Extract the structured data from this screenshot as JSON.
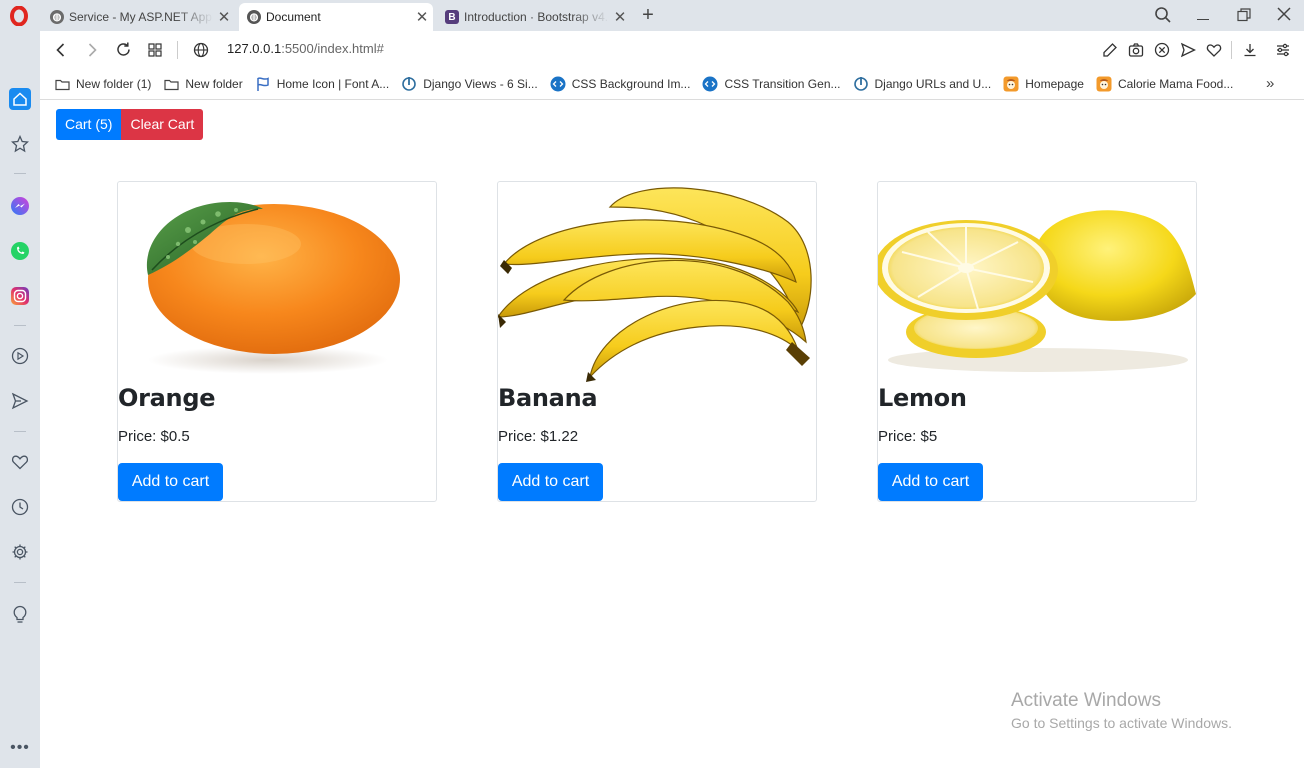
{
  "browser": {
    "tabs": [
      {
        "title": "Service - My ASP.NET Application",
        "active": false
      },
      {
        "title": "Document",
        "active": true
      },
      {
        "title": "Introduction · Bootstrap v4.6",
        "active": false
      }
    ],
    "url": {
      "host": "127.0.0.1",
      "rest": ":5500/index.html#"
    },
    "bookmarks": [
      {
        "label": "New folder (1)",
        "icon": "folder-icon"
      },
      {
        "label": "New folder",
        "icon": "folder-icon"
      },
      {
        "label": "Home Icon | Font A...",
        "icon": "flag-icon"
      },
      {
        "label": "Django Views - 6 Si...",
        "icon": "django-icon"
      },
      {
        "label": "CSS Background Im...",
        "icon": "code-icon"
      },
      {
        "label": "CSS Transition Gen...",
        "icon": "code-icon"
      },
      {
        "label": "Django URLs and U...",
        "icon": "django-icon"
      },
      {
        "label": "Homepage",
        "icon": "calorie-icon"
      },
      {
        "label": "Calorie Mama Food...",
        "icon": "calorie-icon"
      }
    ],
    "colors": {
      "accent": "#007bff",
      "danger": "#dc3545",
      "opera_red": "#e0261f"
    }
  },
  "page": {
    "cart_label": "Cart (5)",
    "clear_label": "Clear Cart",
    "products": [
      {
        "name": "Orange",
        "price": "Price: $0.5",
        "button": "Add to cart",
        "image": "orange-image"
      },
      {
        "name": "Banana",
        "price": "Price: $1.22",
        "button": "Add to cart",
        "image": "banana-image"
      },
      {
        "name": "Lemon",
        "price": "Price: $5",
        "button": "Add to cart",
        "image": "lemon-image"
      }
    ]
  },
  "watermark": {
    "line1": "Activate Windows",
    "line2": "Go to Settings to activate Windows."
  }
}
